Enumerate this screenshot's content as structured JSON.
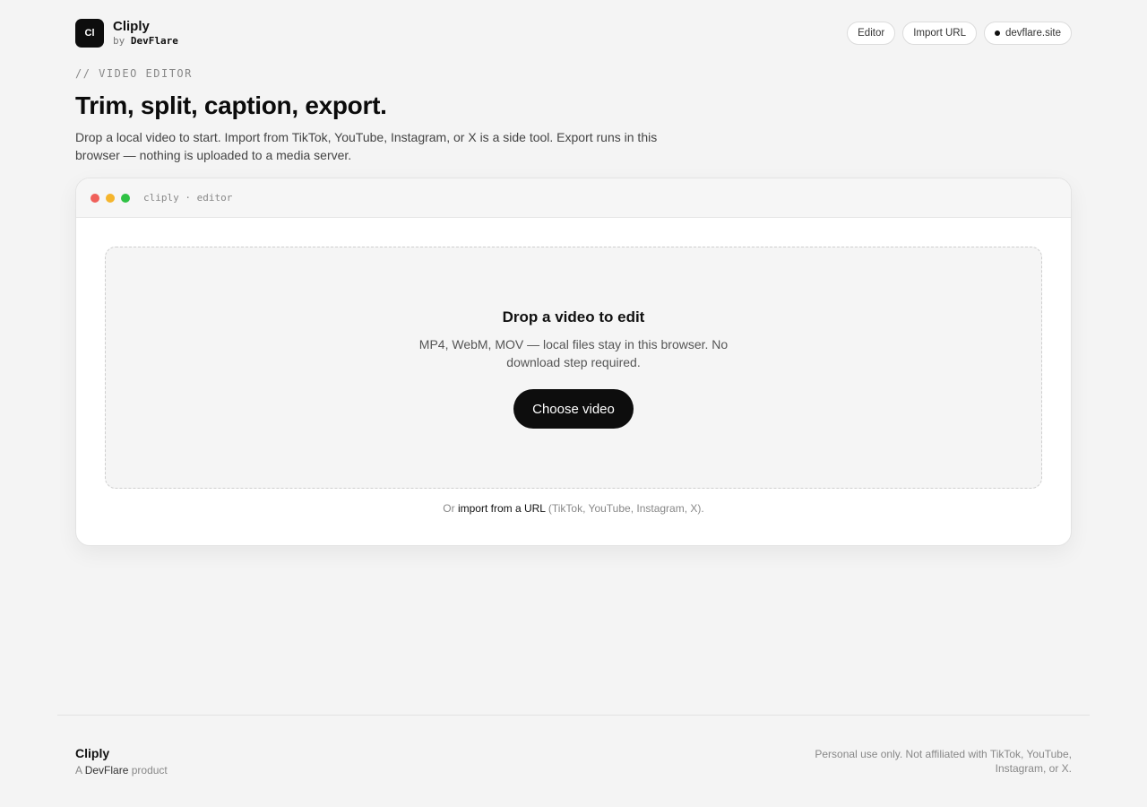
{
  "header": {
    "logo_text": "Cl",
    "brand_name": "Cliply",
    "by_prefix": "by",
    "company": "DevFlare",
    "nav": [
      {
        "label": "Editor"
      },
      {
        "label": "Import URL"
      },
      {
        "label": "devflare.site"
      }
    ]
  },
  "intro": {
    "eyebrow": "// VIDEO EDITOR",
    "title": "Trim, split, caption, export.",
    "subtitle": "Drop a local video to start. Import from TikTok, YouTube, Instagram, or X is a side tool. Export runs in this browser — nothing is uploaded to a media server."
  },
  "editor": {
    "window_label": "cliply · editor",
    "dropzone_title": "Drop a video to edit",
    "dropzone_text": "MP4, WebM, MOV — local files stay in this browser. No download step required.",
    "choose_button": "Choose video",
    "import_prefix": "Or",
    "import_link": "import from a URL",
    "import_suffix": "(TikTok, YouTube, Instagram, X)."
  },
  "footer": {
    "brand_name": "Cliply",
    "by_prefix": "A",
    "company": "DevFlare",
    "by_suffix": "product",
    "disclaimer": "Personal use only. Not affiliated with TikTok, YouTube, Instagram, or X."
  },
  "colors": {
    "background": "#f4f4f4",
    "primary": "#0d0d0d",
    "traffic_red": "#f0605a",
    "traffic_yellow": "#f5b52d",
    "traffic_green": "#2fc244"
  }
}
